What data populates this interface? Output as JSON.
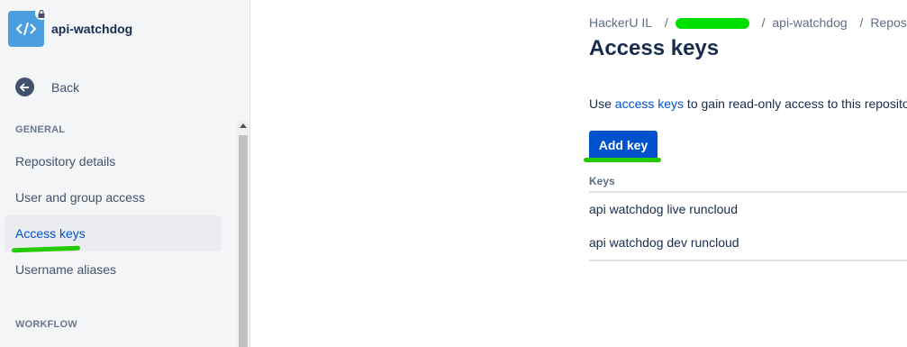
{
  "repo": {
    "name": "api-watchdog",
    "icon": "code-icon",
    "private_icon": "lock-icon",
    "avatar_color": "#4a9fdf"
  },
  "sidebar": {
    "back_label": "Back",
    "sections": [
      {
        "label": "GENERAL",
        "items": [
          {
            "label": "Repository details"
          },
          {
            "label": "User and group access"
          },
          {
            "label": "Access keys",
            "active": true
          },
          {
            "label": "Username aliases"
          }
        ]
      },
      {
        "label": "WORKFLOW",
        "items": []
      }
    ]
  },
  "breadcrumb": {
    "items": [
      "HackerU IL",
      "",
      "api-watchdog",
      "Reposit"
    ],
    "separator": "/"
  },
  "page": {
    "title": "Access keys",
    "description_prefix": "Use ",
    "description_link": "access keys",
    "description_suffix": " to gain read-only access to this repositor",
    "add_button": "Add key"
  },
  "keys_table": {
    "header": "Keys",
    "rows": [
      "api watchdog live runcloud",
      "api watchdog dev runcloud"
    ]
  },
  "colors": {
    "accent": "#0052cc",
    "highlight_marker": "#22cc00"
  }
}
